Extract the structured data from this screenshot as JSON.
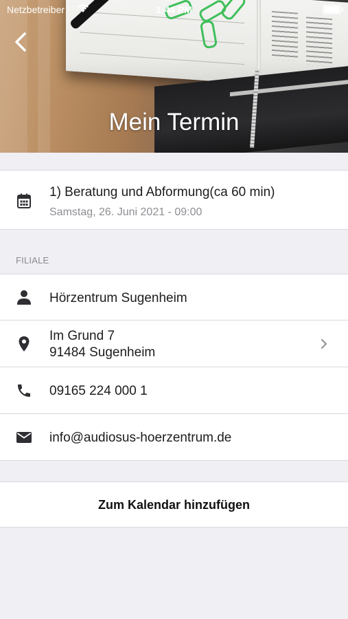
{
  "status_bar": {
    "carrier": "Netzbetreiber",
    "time": "1:44 PM"
  },
  "header": {
    "title": "Mein Termin",
    "back_icon": "chevron-left-icon"
  },
  "appointment": {
    "title": "1) Beratung und Abformung(ca 60 min)",
    "date": "Samstag, 26. Juni 2021 - 09:00",
    "icon": "calendar-icon"
  },
  "branch": {
    "section_label": "FILIALE",
    "name": "Hörzentrum Sugenheim",
    "address_line1": "Im Grund 7",
    "address_line2": "91484 Sugenheim",
    "phone": "09165 224 000 1",
    "email": "info@audiosus-hoerzentrum.de"
  },
  "actions": {
    "add_to_calendar": "Zum Kalendar hinzufügen"
  },
  "colors": {
    "background": "#efeff4",
    "row_background": "#ffffff",
    "icon": "#2f2f33",
    "secondary_text": "#8e8e93"
  }
}
